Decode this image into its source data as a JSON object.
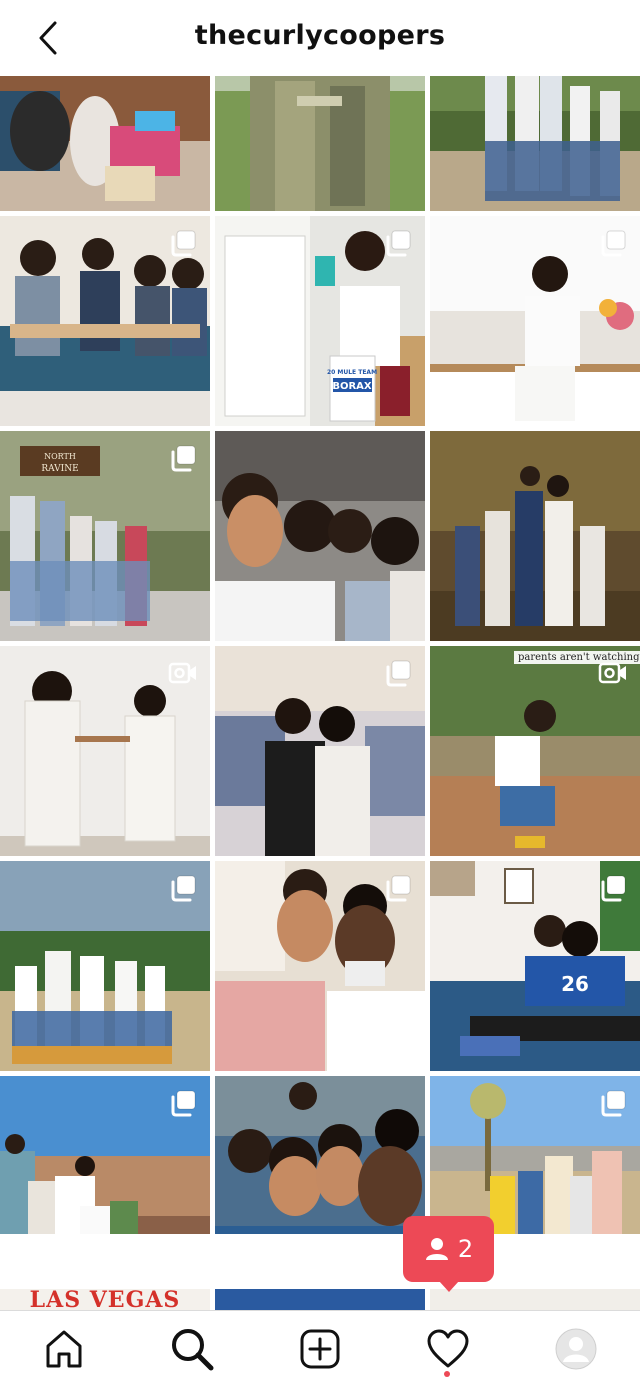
{
  "header": {
    "username": "thecurlycoopers",
    "back_icon": "chevron-left-icon"
  },
  "grid": {
    "tiles": [
      {
        "scene": "family playing with toys on floor",
        "badge": "none"
      },
      {
        "scene": "military uniform",
        "badge": "none"
      },
      {
        "scene": "family posing in forest",
        "badge": "none"
      },
      {
        "scene": "family on couch with products",
        "badge": "carousel"
      },
      {
        "scene": "woman at fridge with Borax",
        "badge": "carousel",
        "product_text": [
          "20 MULE TEAM",
          "BORAX"
        ]
      },
      {
        "scene": "woman in white kitchen",
        "badge": "carousel"
      },
      {
        "scene": "family at sign in woods",
        "badge": "carousel",
        "sign_text": [
          "NORTH",
          "RAVINE"
        ]
      },
      {
        "scene": "family selfie",
        "badge": "none"
      },
      {
        "scene": "family formal in autumn park",
        "badge": "none"
      },
      {
        "scene": "mother and daughter in white dresses",
        "badge": "video"
      },
      {
        "scene": "couple vintage photo",
        "badge": "carousel"
      },
      {
        "scene": "boy jumping outdoors",
        "badge": "video",
        "caption": "parents aren't watching 😉"
      },
      {
        "scene": "family jumping in field",
        "badge": "carousel"
      },
      {
        "scene": "couple selfie",
        "badge": "carousel"
      },
      {
        "scene": "couple on blue couch",
        "badge": "carousel",
        "jersey": "26"
      },
      {
        "scene": "family at grand canyon",
        "badge": "carousel"
      },
      {
        "scene": "family selfie by pool",
        "badge": "none"
      },
      {
        "scene": "family in desert",
        "badge": "carousel"
      }
    ],
    "partial_row_text": "LAS VEGAS"
  },
  "toast": {
    "icon": "person-icon",
    "count": "2"
  },
  "tabbar": {
    "items": [
      "home-icon",
      "search-icon",
      "add-post-icon",
      "activity-heart-icon",
      "profile-avatar"
    ],
    "active": "search-icon"
  },
  "colors": {
    "notification_red": "#ed4956",
    "text": "#111111",
    "divider": "#dbdbdb"
  }
}
